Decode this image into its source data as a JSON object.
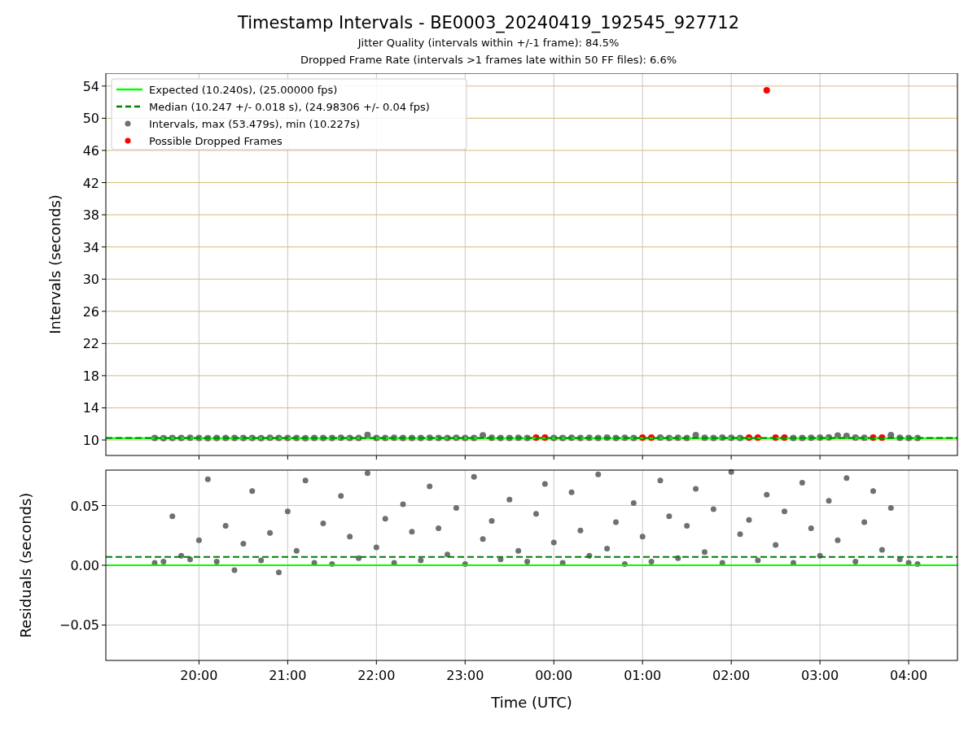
{
  "figure": {
    "title": "Timestamp Intervals - BE0003_20240419_192545_927712",
    "subtitles": [
      "Jitter Quality (intervals within +/-1 frame): 84.5%",
      "Dropped Frame Rate (intervals >1 frames late within 50 FF files): 6.6%"
    ]
  },
  "intervals_chart": {
    "chart_data": {
      "type": "scatter",
      "ylabel": "Intervals (seconds)",
      "ylim": [
        8.08,
        55.6
      ],
      "yticks": [
        10,
        14,
        18,
        22,
        26,
        30,
        34,
        38,
        42,
        46,
        50,
        54
      ],
      "grid": true,
      "legend": true,
      "ref_lines": [
        {
          "axis": "y",
          "value": 10.24,
          "label": "Expected (10.240s), (25.00000 fps)",
          "color": "#00ff00"
        },
        {
          "axis": "y",
          "value": 10.247,
          "label": "Median (10.247 +/- 0.018 s), (24.98306 +/- 0.04 fps)",
          "color": "#008000"
        }
      ],
      "series": [
        {
          "name": "Intervals, max (53.479s), min (10.227s)",
          "color": "#707070",
          "values": [
            null,
            null,
            null,
            null,
            null,
            10.25,
            10.24,
            10.26,
            10.25,
            10.27,
            10.25,
            10.24,
            10.26,
            10.25,
            10.25,
            10.26,
            10.25,
            10.24,
            10.27,
            10.25,
            10.26,
            10.25,
            10.24,
            10.26,
            10.25,
            10.25,
            10.27,
            10.26,
            10.25,
            10.64,
            10.25,
            10.26,
            10.28,
            10.25,
            10.26,
            10.25,
            10.27,
            10.26,
            10.25,
            10.29,
            10.26,
            10.25,
            10.58,
            10.27,
            10.26,
            10.25,
            10.28,
            10.26,
            null,
            null,
            10.25,
            10.26,
            10.27,
            10.25,
            10.28,
            10.26,
            10.3,
            10.25,
            10.27,
            10.26,
            null,
            null,
            10.3,
            10.26,
            10.28,
            10.25,
            10.62,
            10.27,
            10.26,
            10.3,
            10.28,
            10.25,
            null,
            null,
            null,
            null,
            null,
            10.26,
            10.25,
            10.28,
            10.3,
            10.32,
            10.55,
            10.5,
            10.3,
            10.27,
            null,
            null,
            10.62,
            10.28,
            10.26,
            10.25,
            null,
            null,
            null,
            null
          ]
        },
        {
          "name": "Possible Dropped Frames",
          "color": "#ff0000",
          "values": [
            null,
            null,
            null,
            null,
            null,
            null,
            null,
            null,
            null,
            null,
            null,
            null,
            null,
            null,
            null,
            null,
            null,
            null,
            null,
            null,
            null,
            null,
            null,
            null,
            null,
            null,
            null,
            null,
            null,
            null,
            null,
            null,
            null,
            null,
            null,
            null,
            null,
            null,
            null,
            null,
            null,
            null,
            null,
            null,
            null,
            null,
            null,
            null,
            10.3,
            10.3,
            null,
            null,
            null,
            null,
            null,
            null,
            null,
            null,
            null,
            null,
            10.3,
            10.3,
            null,
            null,
            null,
            null,
            null,
            null,
            null,
            null,
            null,
            null,
            10.3,
            10.3,
            53.479,
            10.3,
            10.3,
            null,
            null,
            null,
            null,
            null,
            null,
            null,
            null,
            null,
            10.3,
            10.3,
            null,
            null,
            null,
            null,
            null,
            null,
            null,
            null
          ]
        }
      ]
    }
  },
  "residuals_chart": {
    "chart_data": {
      "type": "scatter",
      "xlabel": "Time (UTC)",
      "ylabel": "Residuals (seconds)",
      "ylim": [
        -0.0796,
        0.0796
      ],
      "grid": true,
      "categories": [
        null,
        null,
        null,
        null,
        null,
        null,
        null,
        null,
        null,
        null,
        "20:00",
        null,
        null,
        null,
        null,
        null,
        null,
        null,
        null,
        null,
        "21:00",
        null,
        null,
        null,
        null,
        null,
        null,
        null,
        null,
        null,
        "22:00",
        null,
        null,
        null,
        null,
        null,
        null,
        null,
        null,
        null,
        "23:00",
        null,
        null,
        null,
        null,
        null,
        null,
        null,
        null,
        null,
        "00:00",
        null,
        null,
        null,
        null,
        null,
        null,
        null,
        null,
        null,
        "01:00",
        null,
        null,
        null,
        null,
        null,
        null,
        null,
        null,
        null,
        "02:00",
        null,
        null,
        null,
        null,
        null,
        null,
        null,
        null,
        null,
        "03:00",
        null,
        null,
        null,
        null,
        null,
        null,
        null,
        null,
        null,
        "04:00",
        null,
        null,
        null,
        null,
        null
      ],
      "yticks": [
        {
          "value": -0.05,
          "label": "−0.05"
        },
        {
          "value": 0,
          "label": "0.00"
        },
        {
          "value": 0.05,
          "label": "0.05"
        }
      ],
      "ref_lines": [
        {
          "axis": "y",
          "value": 0,
          "color": "#00ff00"
        },
        {
          "axis": "y",
          "value": 0.007,
          "color": "#008000"
        }
      ],
      "series": [
        {
          "color": "#707070",
          "values": [
            null,
            null,
            null,
            null,
            null,
            0.002,
            0.003,
            0.041,
            0.008,
            0.005,
            0.021,
            0.072,
            0.003,
            0.033,
            -0.004,
            0.018,
            0.062,
            0.004,
            0.027,
            -0.006,
            0.045,
            0.012,
            0.071,
            0.002,
            0.035,
            0.001,
            0.058,
            0.024,
            0.006,
            0.077,
            0.015,
            0.039,
            0.002,
            0.051,
            0.028,
            0.004,
            0.066,
            0.031,
            0.009,
            0.048,
            0.001,
            0.074,
            0.022,
            0.037,
            0.005,
            0.055,
            0.012,
            0.003,
            0.043,
            0.068,
            0.019,
            0.002,
            0.061,
            0.029,
            0.008,
            0.076,
            0.014,
            0.036,
            0.001,
            0.052,
            0.024,
            0.003,
            0.071,
            0.041,
            0.006,
            0.033,
            0.064,
            0.011,
            0.047,
            0.002,
            0.078,
            0.026,
            0.038,
            0.004,
            0.059,
            0.017,
            0.045,
            0.002,
            0.069,
            0.031,
            0.008,
            0.054,
            0.021,
            0.073,
            0.003,
            0.036,
            0.062,
            0.013,
            0.048,
            0.005,
            0.002,
            0.001,
            null,
            null,
            null,
            null
          ]
        }
      ]
    }
  }
}
